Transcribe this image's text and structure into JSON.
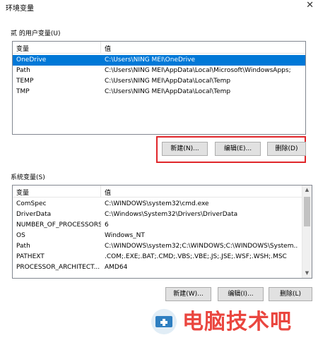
{
  "window": {
    "title": "环境变量"
  },
  "user_vars": {
    "group_label": "贰 的用户变量(U)",
    "columns": [
      "变量",
      "值"
    ],
    "rows": [
      {
        "name": "OneDrive",
        "value": "C:\\Users\\NING MEI\\OneDrive",
        "selected": true
      },
      {
        "name": "Path",
        "value": "C:\\Users\\NING MEI\\AppData\\Local\\Microsoft\\WindowsApps;"
      },
      {
        "name": "TEMP",
        "value": "C:\\Users\\NING MEI\\AppData\\Local\\Temp"
      },
      {
        "name": "TMP",
        "value": "C:\\Users\\NING MEI\\AppData\\Local\\Temp"
      }
    ],
    "buttons": {
      "new": "新建(N)...",
      "edit": "编辑(E)...",
      "delete": "删除(D)"
    }
  },
  "sys_vars": {
    "group_label": "系统变量(S)",
    "columns": [
      "变量",
      "值"
    ],
    "rows": [
      {
        "name": "ComSpec",
        "value": "C:\\WINDOWS\\system32\\cmd.exe"
      },
      {
        "name": "DriverData",
        "value": "C:\\Windows\\System32\\Drivers\\DriverData"
      },
      {
        "name": "NUMBER_OF_PROCESSORS",
        "value": "6"
      },
      {
        "name": "OS",
        "value": "Windows_NT"
      },
      {
        "name": "Path",
        "value": "C:\\WINDOWS\\system32;C:\\WINDOWS;C:\\WINDOWS\\System..."
      },
      {
        "name": "PATHEXT",
        "value": ".COM;.EXE;.BAT;.CMD;.VBS;.VBE;.JS;.JSE;.WSF;.WSH;.MSC"
      },
      {
        "name": "PROCESSOR_ARCHITECT...",
        "value": "AMD64"
      }
    ],
    "buttons": {
      "new": "新建(W)...",
      "edit": "编辑(I)...",
      "delete": "删除(L)"
    }
  },
  "watermark": {
    "text": "电脑技术吧"
  },
  "colors": {
    "selection": "#0078d7",
    "highlight_box": "#e0262a",
    "watermark": "#e8322b"
  }
}
